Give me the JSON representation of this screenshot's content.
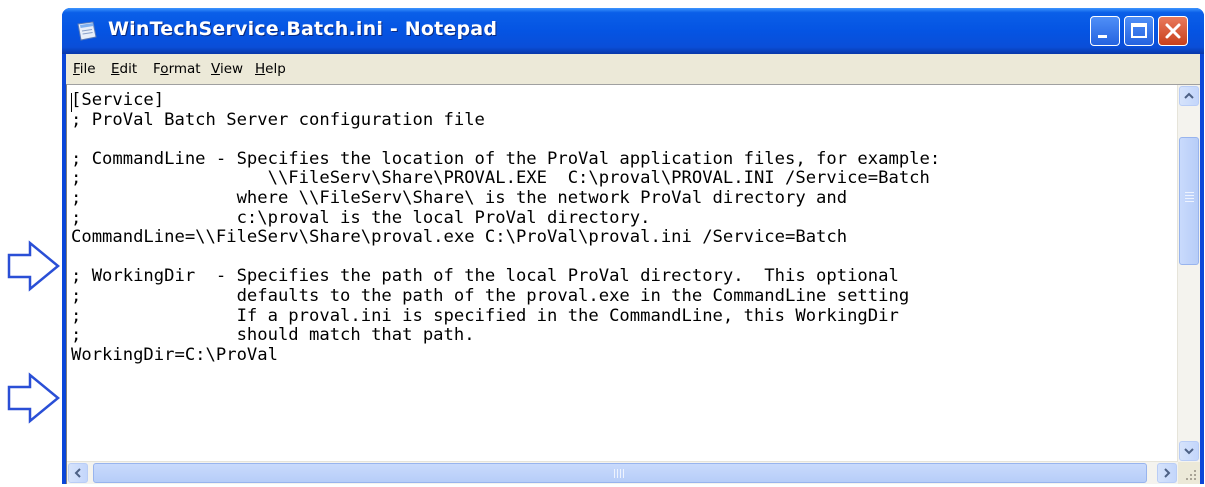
{
  "window": {
    "title": "WinTechService.Batch.ini - Notepad"
  },
  "menu": [
    {
      "label": "File",
      "accel": "F",
      "rest": "ile"
    },
    {
      "label": "Edit",
      "accel": "E",
      "rest": "dit"
    },
    {
      "label": "Format",
      "pre": "F",
      "accel": "o",
      "rest": "rmat"
    },
    {
      "label": "View",
      "accel": "V",
      "rest": "iew"
    },
    {
      "label": "Help",
      "accel": "H",
      "rest": "elp"
    }
  ],
  "editor": {
    "lines": [
      "[Service]",
      "; ProVal Batch Server configuration file",
      "",
      "; CommandLine - Specifies the location of the ProVal application files, for example:",
      ";                  \\\\FileServ\\Share\\PROVAL.EXE  C:\\proval\\PROVAL.INI /Service=Batch",
      ";               where \\\\FileServ\\Share\\ is the network ProVal directory and",
      ";               c:\\proval is the local ProVal directory.",
      "CommandLine=\\\\FileServ\\Share\\proval.exe C:\\ProVal\\proval.ini /Service=Batch",
      "",
      "; WorkingDir  - Specifies the path of the local ProVal directory.  This optional",
      ";               defaults to the path of the proval.exe in the CommandLine setting",
      ";               If a proval.ini is specified in the CommandLine, this WorkingDir",
      ";               should match that path.",
      "WorkingDir=C:\\ProVal"
    ]
  },
  "icons": {
    "app": "notepad-icon",
    "annotation": "arrow-right-outline-icon",
    "minimize": "minimize-icon",
    "maximize": "maximize-icon",
    "close": "close-icon"
  },
  "colors": {
    "titlebar": "#0554e3",
    "close": "#c8401c",
    "annotation_arrow": "#2a4fd6"
  }
}
